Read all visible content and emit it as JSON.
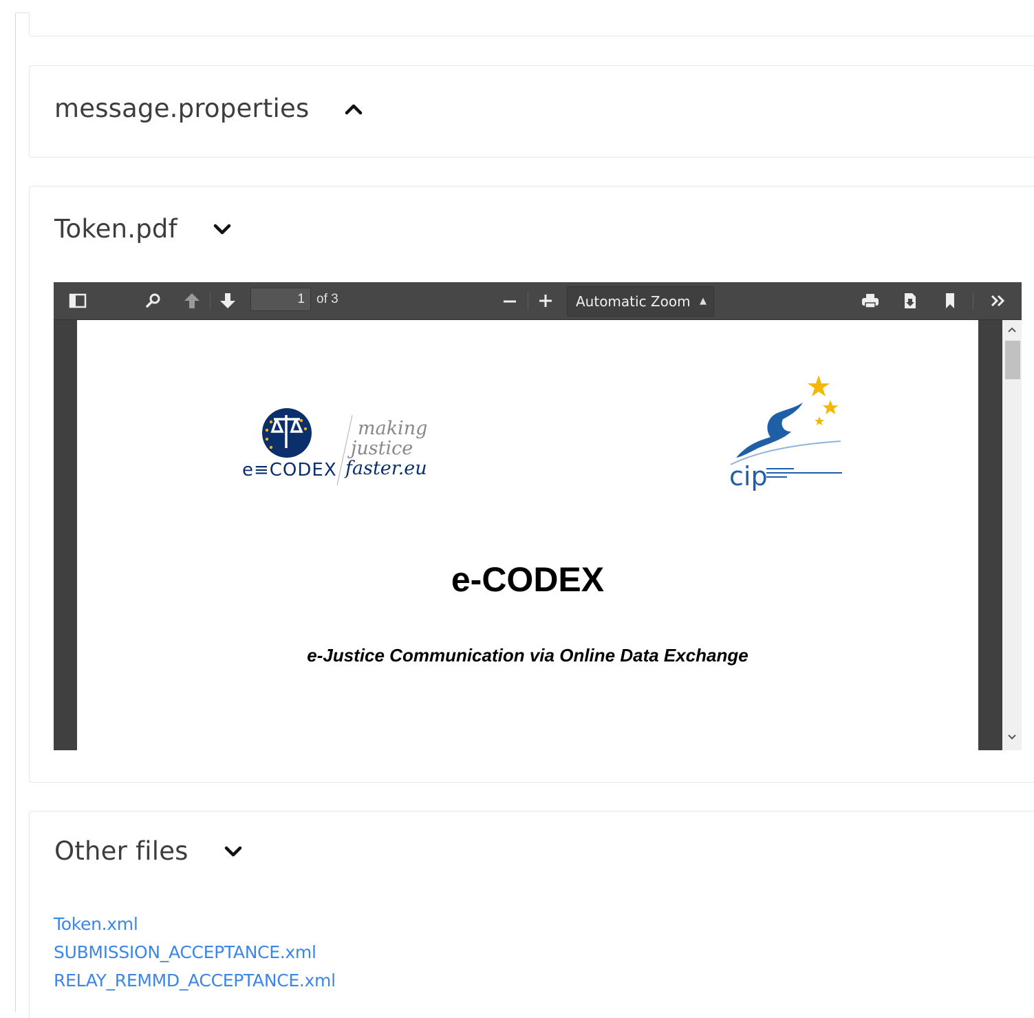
{
  "sections": {
    "message_properties": {
      "title": "message.properties",
      "icon": "chevron-up-icon"
    },
    "token_pdf": {
      "title": "Token.pdf",
      "icon": "chevron-down-icon"
    },
    "other_files": {
      "title": "Other files",
      "icon": "chevron-down-icon",
      "files": [
        "Token.xml",
        "SUBMISSION_ACCEPTANCE.xml",
        "RELAY_REMMD_ACCEPTANCE.xml"
      ]
    }
  },
  "pdf_viewer": {
    "page_number": "1",
    "page_count": "of 3",
    "zoom": "Automatic Zoom",
    "toolbar_icons": [
      "sidebar-toggle-icon",
      "search-icon",
      "previous-page-icon",
      "next-page-icon",
      "zoom-out-icon",
      "zoom-in-icon",
      "print-icon",
      "download-icon",
      "bookmark-icon",
      "tools-icon"
    ],
    "document": {
      "title": "e-CODEX",
      "subtitle": "e-Justice Communication via Online Data Exchange",
      "ecodex_logo": {
        "wordmark": "e≡CODEX",
        "tagline": [
          "making",
          "justice",
          "faster.eu"
        ]
      },
      "cip_logo": {
        "wordmark": "cip"
      }
    }
  },
  "colors": {
    "link": "#3c86e8",
    "toolbar": "#474747",
    "ecodex_blue": "#0a2f6b",
    "cip_blue": "#1f5fa8",
    "star_yellow": "#f5b800"
  }
}
